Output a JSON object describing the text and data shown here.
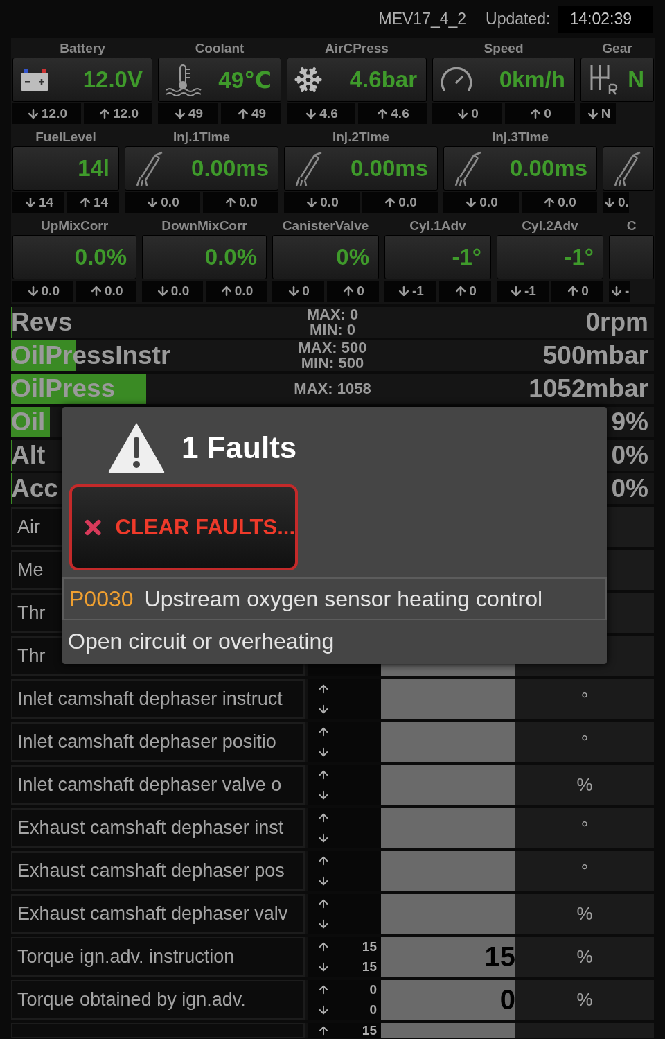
{
  "header": {
    "ecu": "MEV17_4_2",
    "updated_label": "Updated:",
    "time": "14:02:39"
  },
  "gauge_rows": [
    {
      "gauges": [
        {
          "label": "Battery",
          "value": "12.0V",
          "min": "12.0",
          "max": "12.0"
        },
        {
          "label": "Coolant",
          "value": "49℃",
          "min": "49",
          "max": "49"
        },
        {
          "label": "AirCPress",
          "value": "4.6bar",
          "min": "4.6",
          "max": "4.6"
        },
        {
          "label": "Speed",
          "value": "0km/h",
          "min": "0",
          "max": "0"
        },
        {
          "label": "Gear",
          "value": "N",
          "min": "N"
        }
      ]
    },
    {
      "gauges": [
        {
          "label": "FuelLevel",
          "value": "14l",
          "min": "14",
          "max": "14"
        },
        {
          "label": "Inj.1Time",
          "value": "0.00ms",
          "min": "0.0",
          "max": "0.0"
        },
        {
          "label": "Inj.2Time",
          "value": "0.00ms",
          "min": "0.0",
          "max": "0.0"
        },
        {
          "label": "Inj.3Time",
          "value": "0.00ms",
          "min": "0.0",
          "max": "0.0"
        },
        {
          "min": "0."
        }
      ]
    },
    {
      "gauges": [
        {
          "label": "UpMixCorr",
          "value": "0.0%",
          "min": "0.0",
          "max": "0.0"
        },
        {
          "label": "DownMixCorr",
          "value": "0.0%",
          "min": "0.0",
          "max": "0.0"
        },
        {
          "label": "CanisterValve",
          "value": "0%",
          "min": "0",
          "max": "0"
        },
        {
          "label": "Cyl.1Adv",
          "value": "-1°",
          "min": "-1",
          "max": "0"
        },
        {
          "label": "Cyl.2Adv",
          "value": "-1°",
          "min": "-1",
          "max": "0"
        },
        {
          "label": "C",
          "min": "-"
        }
      ]
    }
  ],
  "bars": [
    {
      "label": "Revs",
      "max": "MAX: 0",
      "min": "MIN: 0",
      "value": "0rpm",
      "level": 0
    },
    {
      "label": "OilPressInstr",
      "max": "MAX: 500",
      "min": "MIN: 500",
      "value": "500mbar",
      "level": 0.1
    },
    {
      "label": "OilPress",
      "max": "MAX: 1058",
      "value": "1052mbar",
      "level": 0.21
    },
    {
      "label": "Oil",
      "value": "9%",
      "level": 0.06
    },
    {
      "label": "Alt",
      "value": "0%",
      "level": 0
    },
    {
      "label": "Acc",
      "value": "0%",
      "level": 0
    }
  ],
  "table_rows": [
    {
      "kind": "covered",
      "label": "Air"
    },
    {
      "kind": "covered",
      "label": "Me"
    },
    {
      "kind": "covered",
      "label": "Thr"
    },
    {
      "kind": "covered_top",
      "label": "Thr"
    },
    {
      "kind": "full",
      "label": "Inlet camshaft dephaser instruct",
      "unit": "°"
    },
    {
      "kind": "full",
      "label": "Inlet camshaft dephaser positio",
      "unit": "°"
    },
    {
      "kind": "full",
      "label": "Inlet camshaft dephaser valve o",
      "unit": "%"
    },
    {
      "kind": "full",
      "label": "Exhaust camshaft dephaser inst",
      "unit": "°"
    },
    {
      "kind": "full",
      "label": "Exhaust camshaft dephaser pos",
      "unit": "°"
    },
    {
      "kind": "full",
      "label": "Exhaust camshaft dephaser valv",
      "unit": "%"
    },
    {
      "kind": "full",
      "label": "Torque ign.adv. instruction",
      "max": "15",
      "min": "15",
      "value": "15",
      "unit": "%"
    },
    {
      "kind": "full",
      "label": "Torque obtained by ign.adv.",
      "max": "0",
      "min": "0",
      "value": "0",
      "unit": "%"
    },
    {
      "kind": "partial",
      "max": "15"
    }
  ],
  "fault_dialog": {
    "title": "1 Faults",
    "clear_button": "CLEAR FAULTS...",
    "faults": [
      {
        "code": "P0030",
        "description": "Upstream oxygen sensor heating control",
        "detail": "Open circuit or overheating"
      }
    ]
  }
}
